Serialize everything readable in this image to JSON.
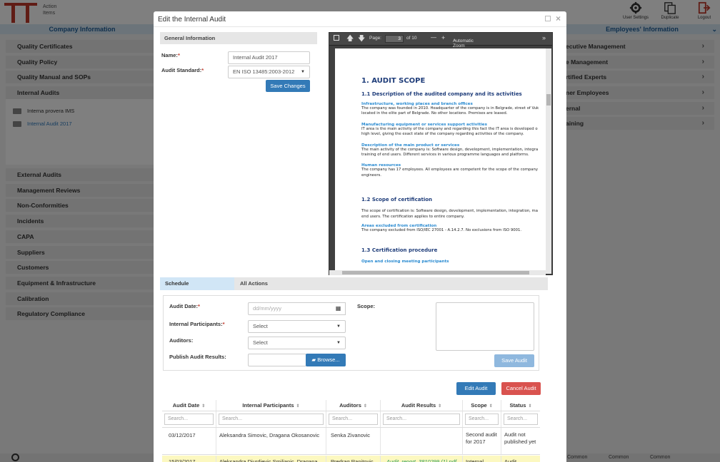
{
  "app": {
    "action_items_line1": "Action",
    "action_items_line2": "Items",
    "user_settings": "User Settings",
    "duplicate": "Duplicate",
    "logout": "Logout",
    "left_section_title": "Company Information",
    "right_section_title": "Employees' Information",
    "left_items_top": [
      "Quality Certificates",
      "Quality Policy",
      "Quality Manual and SOPs",
      "Internal Audits"
    ],
    "left_folders": [
      "Interna provera IMS",
      "Internal Audit 2017"
    ],
    "left_items_bottom": [
      "External Audits",
      "Management Reviews",
      "Non-Conformities",
      "Incidents",
      "CAPA",
      "Suppliers",
      "Customers",
      "Equipment & Infrastructure",
      "Calibration",
      "Regulatory Compliance"
    ],
    "right_items": [
      "ecutive Management",
      "e Management",
      "rtified Experts",
      "ner Employees",
      "ernal",
      "aining"
    ],
    "bottom_common": [
      "Common",
      "Common",
      "Common"
    ]
  },
  "modal": {
    "title": "Edit the Internal Audit",
    "general_info": "General Information",
    "name_label": "Name:",
    "name_value": "Internal Audit 2017",
    "standard_label": "Audit Standard:",
    "standard_value": "EN ISO 13485:2003-2012",
    "save_changes": "Save Changes",
    "req": "*"
  },
  "pdf": {
    "page_label": "Page:",
    "page_value": "3",
    "of_pages": "of 10",
    "zoom": "Automatic Zoom",
    "minus": "—",
    "plus": "+",
    "more": "»",
    "h1": "1. AUDIT SCOPE",
    "h2a": "1.1 Description of the audited company and its activities",
    "h3a": "Infrastructure, working places and branch offices",
    "pa": "The company was founded in 2010. Headquarter of the company is in Belgrade, street of Vuk\nlocated in the elite part of Belgrade. No other locations. Premises are leased.",
    "h3b": "Manufacturing equipment or services support activities",
    "pb": "IT area is the main activity of the company and regarding this fact the IT area is developed o\nhigh level, giving the exact state of the company regarding activities of the company.",
    "h3c": "Description of the main product or services",
    "pc": "The main activity of the company is: Software design, development, implementation, integra\ntraining of end users. Different services in various programme languages and platforms.",
    "h3d": "Human resources",
    "pd": "The company has 17 employees. All employees are competent for the scope of the company\nengineers.",
    "h2b": "1.2 Scope of certification",
    "pe": "The scope of certification is: Software design, development, implementation, integration, ma\nend users. The certification applies to entire company.",
    "h3e": "Areas excluded from certification",
    "pf": "The company excluded from ISO/IEC 27001 - A.14.2.7. No exclusions from ISO 9001.",
    "h2c": "1.3 Certification procedure",
    "h3f": "Open and closing meeting participants"
  },
  "tabs": {
    "schedule": "Schedule",
    "all_actions": "All Actions"
  },
  "schedule": {
    "audit_date_label": "Audit Date:",
    "audit_date_placeholder": "dd/mm/yyyy",
    "participants_label": "Internal Participants:",
    "participants_value": "Select",
    "auditors_label": "Auditors:",
    "auditors_value": "Select",
    "publish_label": "Publish Audit Results:",
    "browse": "Browse...",
    "scope_label": "Scope:",
    "save_audit": "Save Audit"
  },
  "actions": {
    "edit_audit": "Edit Audit",
    "cancel_audit": "Cancel Audit"
  },
  "table": {
    "headers": [
      "Audit Date",
      "Internal Participants",
      "Auditors",
      "Audit Results",
      "Scope",
      "Status"
    ],
    "search_placeholder": "Search...",
    "rows": [
      [
        "03/12/2017",
        "Aleksandra Simovic, Dragana Okosanovic",
        "Senka Zivanovic",
        "",
        "Second audit for 2017",
        "Audit not published yet"
      ],
      [
        "15/03/2017",
        "Aleksandra Djurdjevic Smiljanic, Dragana",
        "Predrag Ranitovic",
        "Audit_report_3810299 (1).pdf",
        "Internal",
        "Audit"
      ]
    ]
  },
  "colors": {
    "accent": "#337ab7",
    "danger": "#d9534f",
    "highlight_row": "#fcf8c0",
    "brand_red": "#c0392b"
  }
}
